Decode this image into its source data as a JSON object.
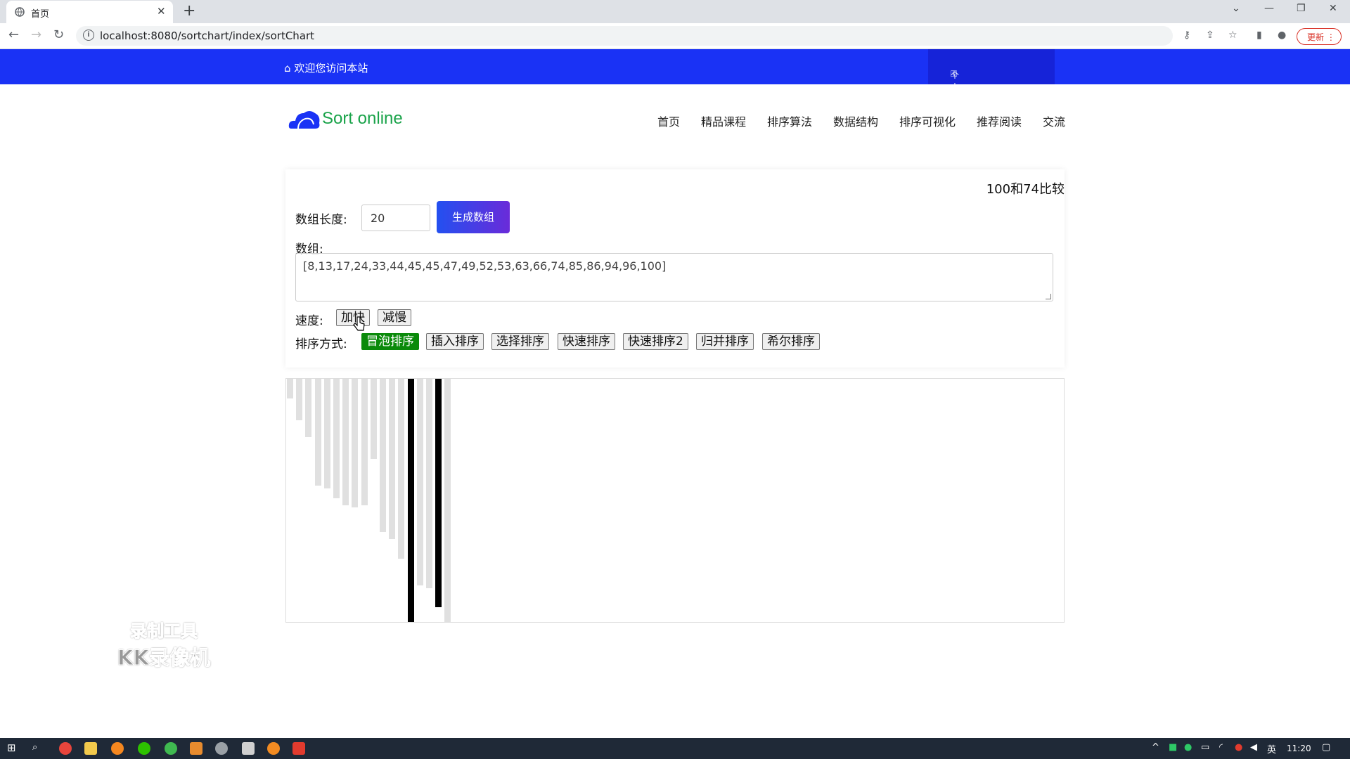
{
  "browser": {
    "tab_title": "首页",
    "url": "localhost:8080/sortchart/index/sortChart",
    "update_label": "更新"
  },
  "site": {
    "welcome": "欢迎您访问本站",
    "user_center": "个人中心",
    "logo_text": "Sort online",
    "nav": [
      "首页",
      "精品课程",
      "排序算法",
      "数据结构",
      "排序可视化",
      "推荐阅读",
      "交流"
    ]
  },
  "panel": {
    "compare_text": "100和74比较",
    "length_label": "数组长度:",
    "length_value": "20",
    "generate_label": "生成数组",
    "array_label": "数组:",
    "array_value": "[8,13,17,24,33,44,45,45,47,49,52,53,63,66,74,85,86,94,96,100]",
    "speed_label": "速度:",
    "speed_buttons": [
      "加快",
      "减慢"
    ],
    "method_label": "排序方式:",
    "methods": [
      "冒泡排序",
      "插入排序",
      "选择排序",
      "快速排序",
      "快速排序2",
      "归并排序",
      "希尔排序"
    ],
    "active_method": "冒泡排序"
  },
  "chart_data": {
    "type": "bar",
    "values": [
      8,
      17,
      24,
      44,
      45,
      49,
      52,
      53,
      52,
      33,
      63,
      66,
      74,
      100,
      85,
      86,
      94,
      100
    ],
    "highlighted_indices": [
      13,
      16
    ],
    "colors": {
      "normal": "#e0e0e0",
      "highlight": "#000000"
    }
  },
  "watermark": {
    "line1": "录制工具",
    "line2": "KK录像机"
  },
  "taskbar": {
    "ime": "英",
    "time": "11:20"
  }
}
